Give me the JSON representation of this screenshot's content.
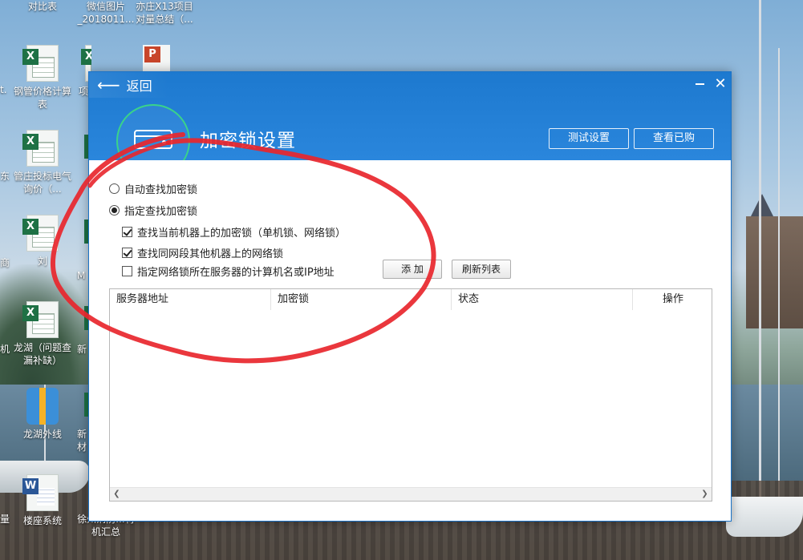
{
  "desktop": {
    "icons": [
      {
        "label": "对比表",
        "type": "none"
      },
      {
        "label": "微信图片_2018011...",
        "type": "none"
      },
      {
        "label": "亦庄X13项目对量总结（...",
        "type": "none"
      },
      {
        "label": "钢管价格计算表",
        "type": "xls"
      },
      {
        "label": "项",
        "type": "xls"
      },
      {
        "label": "管庄投标电气询价（...",
        "type": "xls"
      },
      {
        "label": "刘",
        "type": "xls"
      },
      {
        "label": "龙湖（问题查漏补缺）",
        "type": "xls"
      },
      {
        "label": "龙湖外线",
        "type": "zip"
      },
      {
        "label": "楼座系统",
        "type": "doc"
      },
      {
        "label": "徐州消防...材机汇总",
        "type": "none"
      }
    ],
    "partials": {
      "p1": "t.",
      "p2": "东",
      "p3": "",
      "p4": "商",
      "p5": "M",
      "p6": "机",
      "p7": "新",
      "p8": "新",
      "p9": "材",
      "p10": "量"
    }
  },
  "dialog": {
    "back_label": "返回",
    "minimize_icon": "minus-icon",
    "close_icon": "close-icon",
    "title": "加密锁设置",
    "test_settings_label": "测试设置",
    "view_purchased_label": "查看已购",
    "radio_auto": "自动查找加密锁",
    "radio_specified": "指定查找加密锁",
    "check_local": "查找当前机器上的加密锁（单机锁、网络锁）",
    "check_segment": "查找同网段其他机器上的网络锁",
    "check_server": "指定网络锁所在服务器的计算机名或IP地址",
    "add_label": "添 加",
    "refresh_label": "刷新列表",
    "table": {
      "columns": [
        "服务器地址",
        "加密锁",
        "状态",
        "操作"
      ],
      "rows": []
    },
    "state": {
      "auto_selected": false,
      "specified_selected": true,
      "local_checked": true,
      "segment_checked": true,
      "server_checked": false
    }
  },
  "colors": {
    "header_blue": "#1d79cf",
    "accent_green": "#3ad38a",
    "annotation_red": "#e8262c"
  }
}
